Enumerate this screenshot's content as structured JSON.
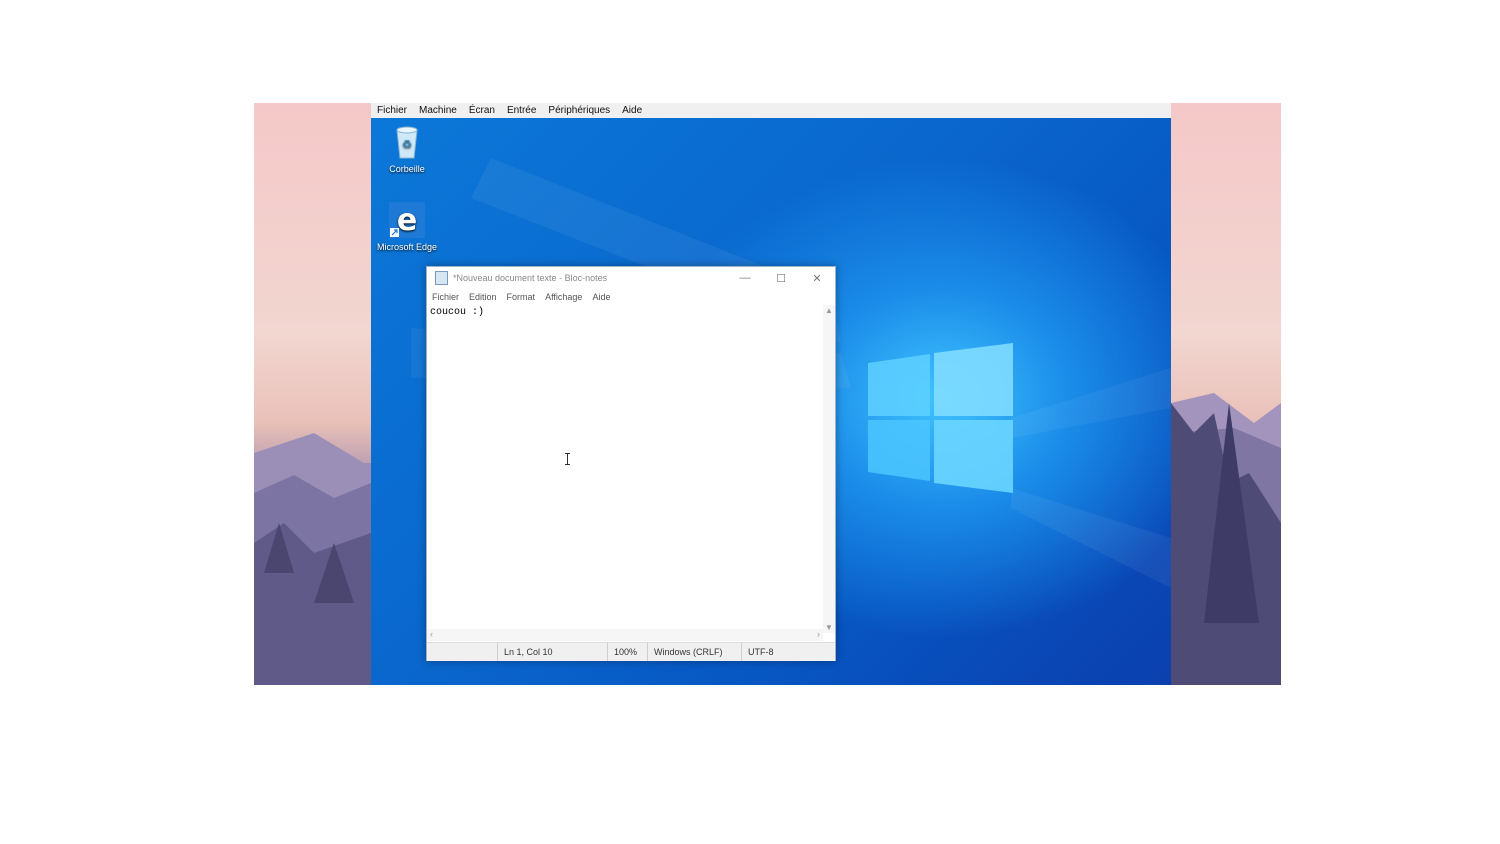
{
  "vm_menu": [
    "Fichier",
    "Machine",
    "Écran",
    "Entrée",
    "Périphériques",
    "Aide"
  ],
  "desktop_icons": [
    {
      "label": "Corbeille",
      "icon": "recycle-bin-icon"
    },
    {
      "label": "Microsoft Edge",
      "icon": "edge-icon"
    }
  ],
  "notepad": {
    "title": "*Nouveau document texte - Bloc-notes",
    "controls": {
      "minimize": "—",
      "maximize": "☐",
      "close": "✕"
    },
    "menu": [
      "Fichier",
      "Edition",
      "Format",
      "Affichage",
      "Aide"
    ],
    "content": "coucou :)",
    "status": {
      "position": "Ln 1, Col 10",
      "zoom": "100%",
      "line_ending": "Windows (CRLF)",
      "encoding": "UTF-8"
    }
  },
  "colors": {
    "desktop_blue": "#0a6fd8",
    "menubar": "#f0f0f0",
    "wallpaper_pink": "#f4c8c8",
    "wallpaper_purple": "#5e5a86"
  }
}
